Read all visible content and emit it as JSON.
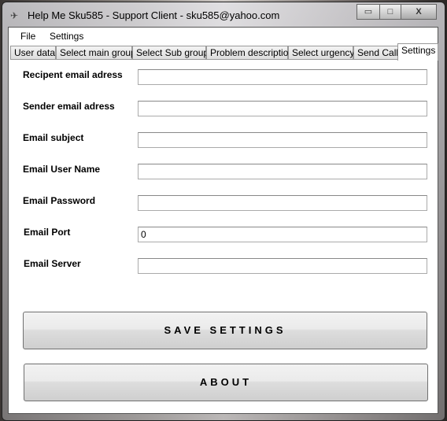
{
  "window": {
    "title": "Help Me Sku585 - Support Client - sku585@yahoo.com",
    "minimize": "▭",
    "maximize": "□",
    "close": "X"
  },
  "menu": [
    "File",
    "Settings"
  ],
  "tabs": [
    "User data",
    "Select main group",
    "Select Sub group",
    "Problem description",
    "Select urgency",
    "Send Call",
    "Settings"
  ],
  "active_tab": "Settings",
  "fields": [
    {
      "label": "Recipent email adress",
      "value": ""
    },
    {
      "label": "Sender email adress",
      "value": ""
    },
    {
      "label": "Email subject",
      "value": ""
    },
    {
      "label": "Email User Name",
      "value": ""
    },
    {
      "label": "Email Password",
      "value": ""
    },
    {
      "label": "Email Port",
      "value": "0"
    },
    {
      "label": "Email Server",
      "value": ""
    }
  ],
  "buttons": {
    "save": "SAVE SETTINGS",
    "about": "ABOUT"
  }
}
